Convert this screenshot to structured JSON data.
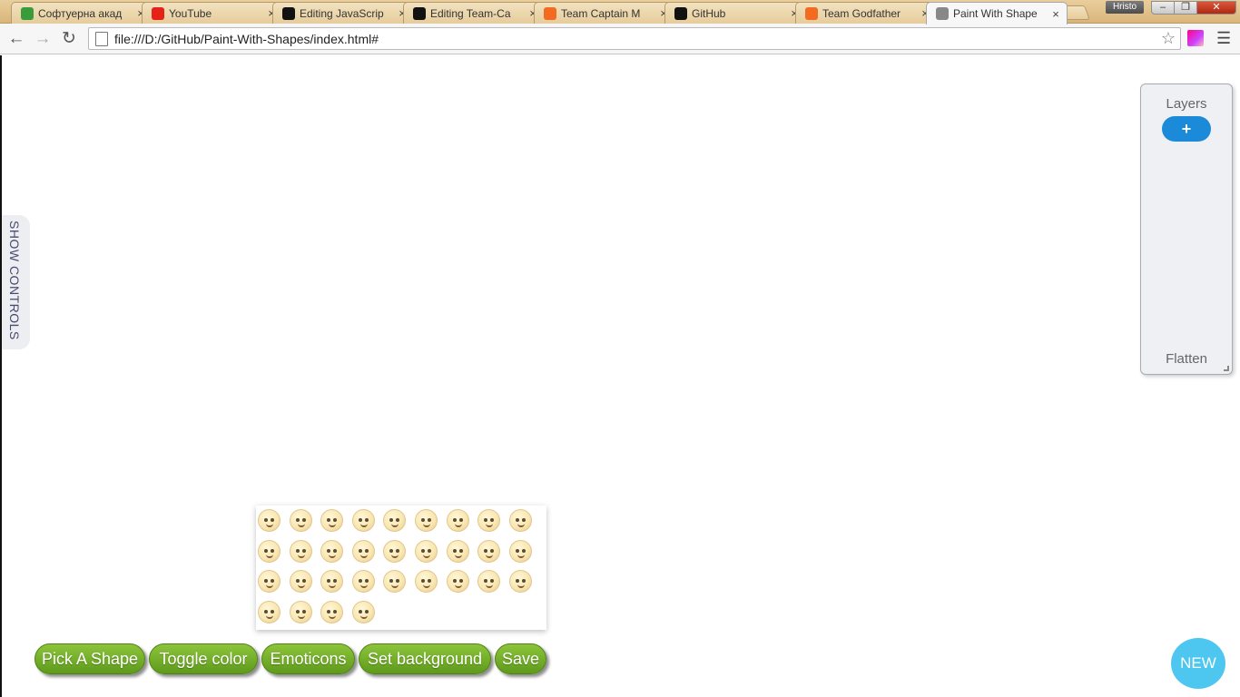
{
  "browser": {
    "tabs": [
      {
        "title": "Софтуерна акад",
        "icon": "softuni-icon",
        "color": "#3a9b3a",
        "active": false
      },
      {
        "title": "YouTube",
        "icon": "youtube-icon",
        "color": "#e62117",
        "active": false
      },
      {
        "title": "Editing JavaScrip",
        "icon": "github-icon",
        "color": "#111111",
        "active": false
      },
      {
        "title": "Editing Team-Ca",
        "icon": "github-icon",
        "color": "#111111",
        "active": false
      },
      {
        "title": "Team Captain M",
        "icon": "telerik-icon",
        "color": "#f26b21",
        "active": false
      },
      {
        "title": "GitHub",
        "icon": "github-icon",
        "color": "#111111",
        "active": false
      },
      {
        "title": "Team Godfather",
        "icon": "telerik-icon",
        "color": "#f26b21",
        "active": false
      },
      {
        "title": "Paint With Shape",
        "icon": "page-icon",
        "color": "#888888",
        "active": true
      }
    ],
    "profile_name": "Hristo",
    "address": {
      "url": "file:///D:/GitHub/Paint-With-Shapes/index.html#"
    }
  },
  "page": {
    "show_controls_label": "SHOW CONTROLS",
    "layers": {
      "title": "Layers",
      "add_label": "+",
      "flatten_label": "Flatten"
    },
    "emoticons": {
      "count": 31
    },
    "buttons": {
      "pick_shape": "Pick A Shape",
      "toggle_color": "Toggle color",
      "emoticons": "Emoticons",
      "set_background": "Set background",
      "save": "Save"
    },
    "new_label": "NEW",
    "colors": {
      "accent_green": "#6fa924",
      "layer_add_blue": "#1b8ad8",
      "new_button": "#4ec7f0"
    }
  }
}
